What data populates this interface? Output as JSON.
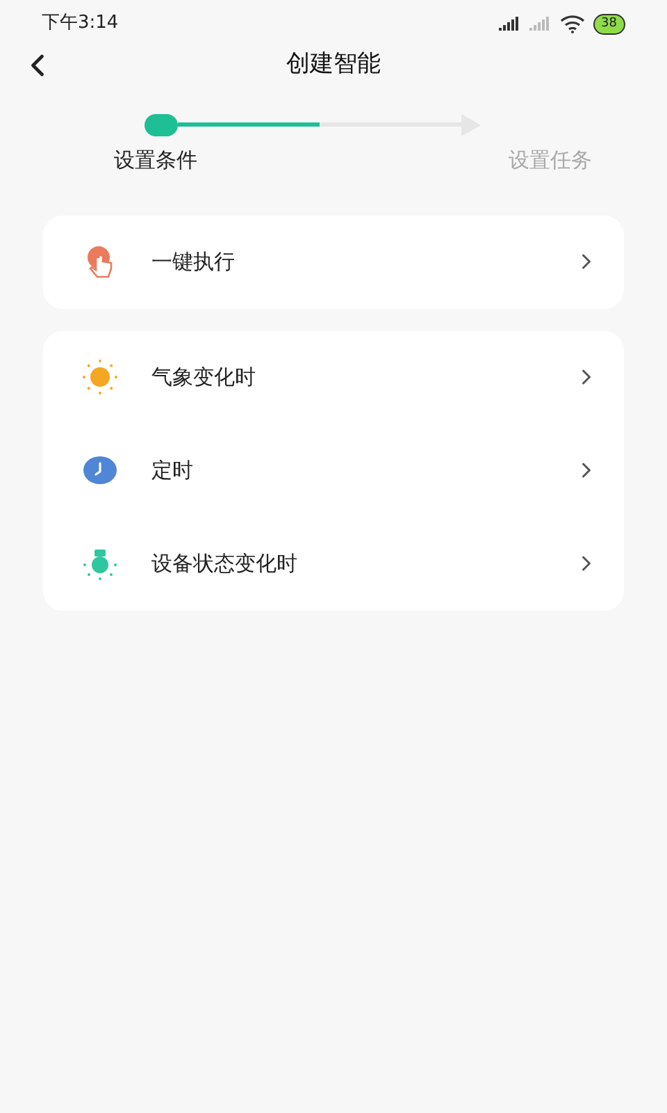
{
  "status_bar": {
    "time": "下午3:14",
    "battery": "38"
  },
  "header": {
    "title": "创建智能"
  },
  "stepper": {
    "level": 0.5,
    "steps": [
      {
        "label": "设置条件",
        "selected": true
      },
      {
        "label": "设置任务",
        "selected": false
      }
    ]
  },
  "groups": [
    {
      "items": [
        {
          "kind": "tap",
          "label": "一键执行"
        }
      ]
    },
    {
      "items": [
        {
          "kind": "weather",
          "label": "气象变化时"
        },
        {
          "kind": "timer",
          "label": "定时"
        },
        {
          "kind": "device",
          "label": "设备状态变化时"
        }
      ]
    }
  ]
}
